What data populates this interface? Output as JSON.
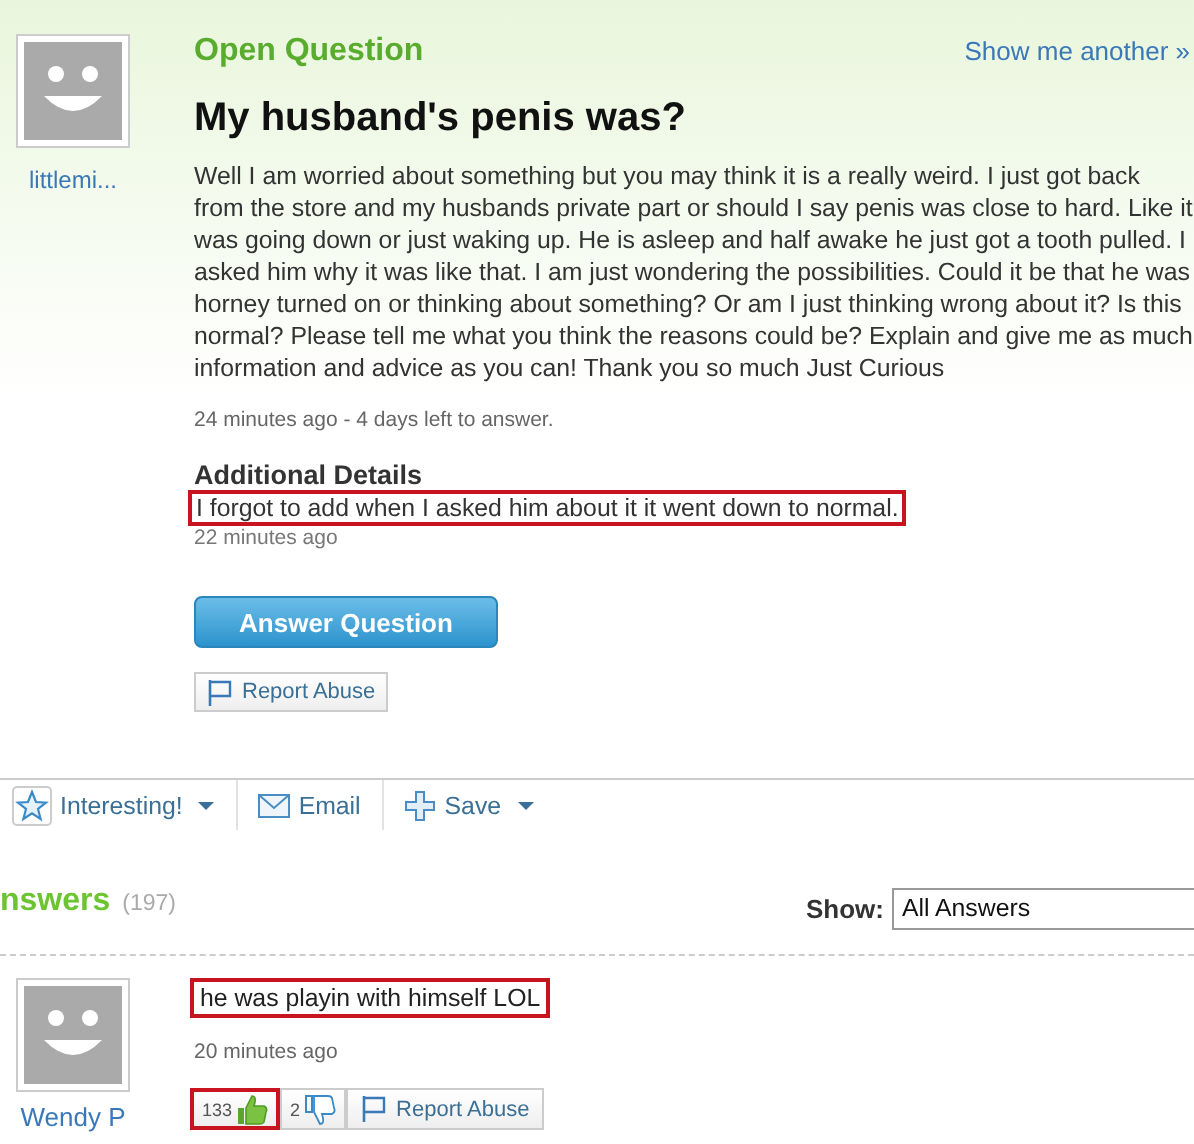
{
  "question": {
    "avatar_name": "littlemi...",
    "status": "Open Question",
    "show_another": "Show me another »",
    "title": "My husband's penis was?",
    "body": "Well I am worried about something but you may think it is a really weird. I just got back from the store and my husbands private part or should I say penis was close to hard. Like it was going down or just waking up. He is asleep and half awake he just got a tooth pulled. I asked him why it was like that. I am just wondering the possibilities. Could it be that he was horney turned on or thinking about something? Or am I just thinking wrong about it? Is this normal? Please tell me what you think the reasons could be? Explain and give me as much information and advice as you can! Thank you so much Just Curious",
    "meta": "24 minutes ago - 4 days left to answer.",
    "additional": {
      "heading": "Additional Details",
      "text": "I forgot to add when I asked him about it it went down to normal.",
      "highlighted": true,
      "time": "22 minutes ago"
    },
    "answer_button": "Answer Question",
    "report": "Report Abuse"
  },
  "toolbar": [
    {
      "kind": "interesting",
      "label": "Interesting!",
      "dropdown": true
    },
    {
      "kind": "email",
      "label": "Email",
      "dropdown": false
    },
    {
      "kind": "save",
      "label": "Save",
      "dropdown": true
    }
  ],
  "answers": {
    "heading": "nswers",
    "count": "(197)",
    "show_label": "Show:",
    "show_value": "All Answers",
    "items": [
      {
        "user": "Wendy P",
        "text": "he was playin with himself LOL",
        "highlighted": true,
        "time": "20 minutes ago",
        "up": "133",
        "up_highlighted": true,
        "down": "2",
        "report": "Report Abuse"
      }
    ]
  }
}
